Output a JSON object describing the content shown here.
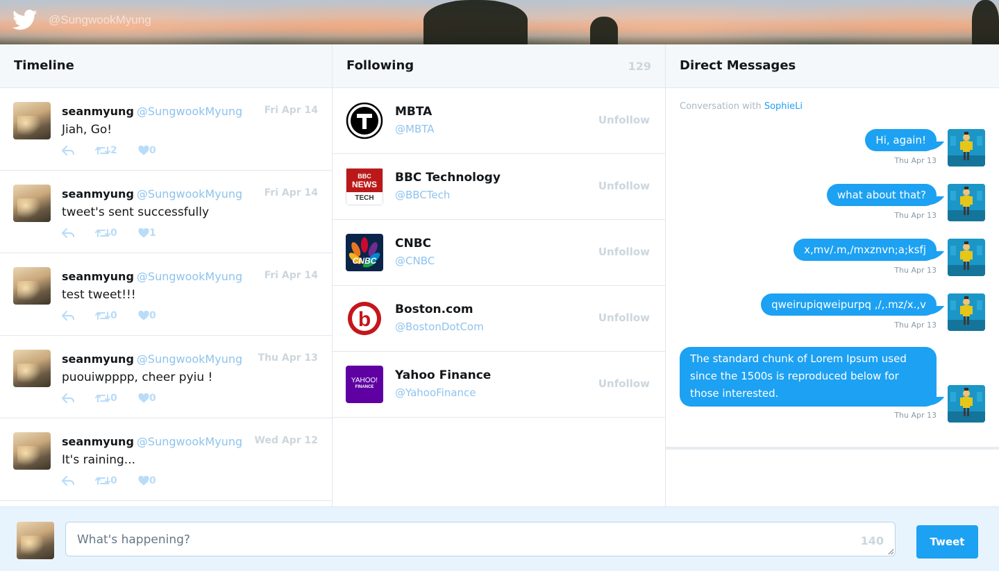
{
  "header": {
    "handle": "@SungwookMyung",
    "logo_icon": "twitter-bird-icon"
  },
  "timeline": {
    "title": "Timeline",
    "tweets": [
      {
        "name": "seanmyung",
        "username": "@SungwookMyung",
        "date": "Fri Apr 14",
        "text": "Jiah, Go!",
        "retweets": "2",
        "likes": "0"
      },
      {
        "name": "seanmyung",
        "username": "@SungwookMyung",
        "date": "Fri Apr 14",
        "text": "tweet's sent successfully",
        "retweets": "0",
        "likes": "1"
      },
      {
        "name": "seanmyung",
        "username": "@SungwookMyung",
        "date": "Fri Apr 14",
        "text": "test tweet!!!",
        "retweets": "0",
        "likes": "0"
      },
      {
        "name": "seanmyung",
        "username": "@SungwookMyung",
        "date": "Thu Apr 13",
        "text": "puouiwpppp, cheer pyiu !",
        "retweets": "0",
        "likes": "0"
      },
      {
        "name": "seanmyung",
        "username": "@SungwookMyung",
        "date": "Wed Apr 12",
        "text": "It's raining...",
        "retweets": "0",
        "likes": "0"
      }
    ]
  },
  "following": {
    "title": "Following",
    "count": "129",
    "unfollow_label": "Unfollow",
    "accounts": [
      {
        "name": "MBTA",
        "handle": "@MBTA",
        "logo_text": "T"
      },
      {
        "name": "BBC Technology",
        "handle": "@BBCTech",
        "logo_text": [
          "BBC",
          "NEWS",
          "TECH"
        ]
      },
      {
        "name": "CNBC",
        "handle": "@CNBC",
        "logo_text": "CNBC"
      },
      {
        "name": "Boston.com",
        "handle": "@BostonDotCom",
        "logo_text": "b"
      },
      {
        "name": "Yahoo Finance",
        "handle": "@YahooFinance",
        "logo_text": [
          "YAHOO!",
          "FINANCE"
        ]
      }
    ]
  },
  "direct_messages": {
    "title": "Direct Messages",
    "conversation_prefix": "Conversation with",
    "conversation_with": "SophieLi",
    "messages": [
      {
        "text": "Hi, again!",
        "date": "Thu Apr 13"
      },
      {
        "text": "what about that?",
        "date": "Thu Apr 13"
      },
      {
        "text": "x,mv/.m,/mxznvn;a;ksfj",
        "date": "Thu Apr 13"
      },
      {
        "text": "qweirupiqweipurpq ,/,.mz/x.,v",
        "date": "Thu Apr 13"
      },
      {
        "text": "The standard chunk of Lorem Ipsum used since the 1500s is reproduced below for those interested.",
        "date": "Thu Apr 13"
      }
    ]
  },
  "compose": {
    "placeholder": "What's happening?",
    "counter": "140",
    "button_label": "Tweet"
  },
  "colors": {
    "accent": "#1da1f2",
    "username": "#8ec3ed",
    "muted": "#ccd6dd",
    "compose_bg": "#e8f4fd"
  }
}
